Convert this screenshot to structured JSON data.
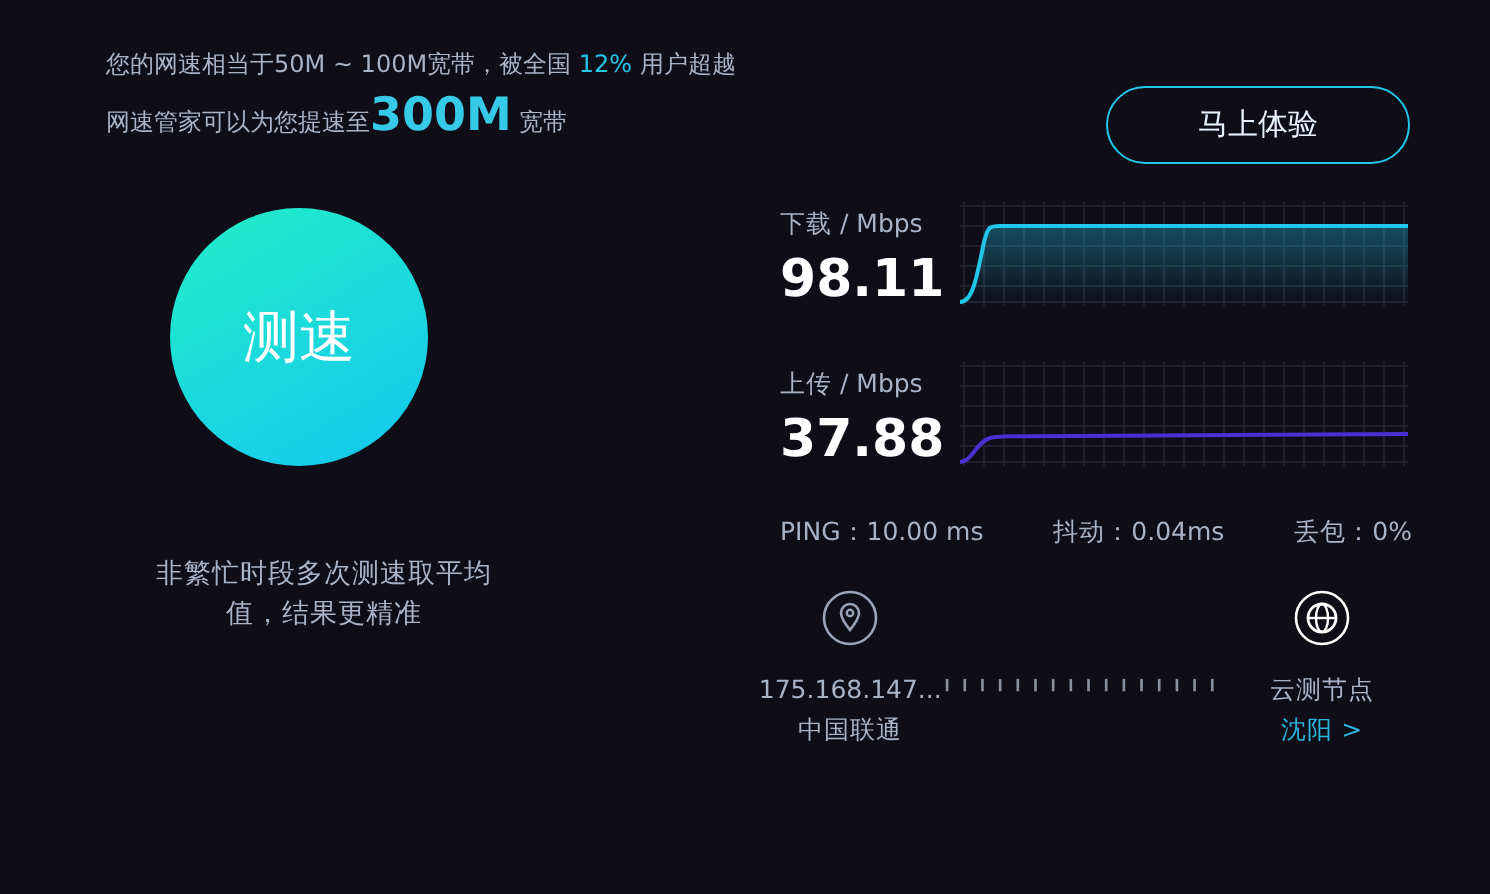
{
  "summary": {
    "line_1": "您的网速相当于50M ~ 100M宽带，被全国 **12%** 用户超越",
    "line_2": "网速管家可以为您提速至**300M** 宽带"
  },
  "try_button": "马上体验",
  "speed_button": "测速",
  "tip": "非繁忙时段多次测速取平均值，结果更精准",
  "meters": [
    {
      "kind": "download",
      "label": "下载 / Mbps",
      "value": "98.11"
    },
    {
      "kind": "upload",
      "label": "上传 / Mbps",
      "value": "37.88"
    }
  ],
  "stats": [
    "PING：10.00 ms",
    "抖动：0.04ms",
    "丢包：0%"
  ],
  "client": {
    "ip": "175.168.147...",
    "isp": "中国联通"
  },
  "node": {
    "title": "云测节点",
    "city": "沈阳 >"
  }
}
